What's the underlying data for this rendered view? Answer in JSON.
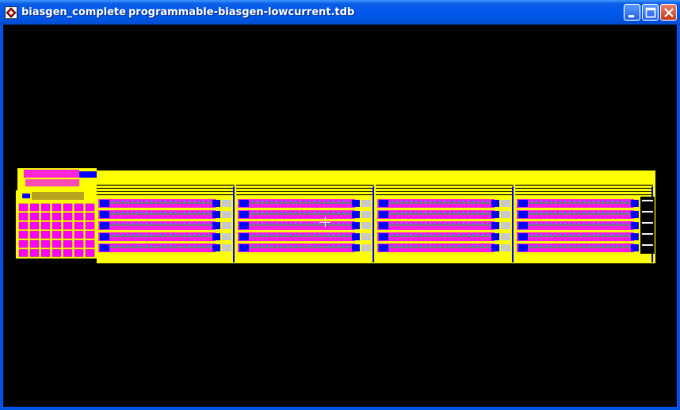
{
  "window": {
    "cell_name": "biasgen_complete",
    "file_name": "programmable-biasgen-lowcurrent.tdb"
  },
  "icons": {
    "app": "layout-editor-icon",
    "minimize": "minimize-icon",
    "maximize": "maximize-icon",
    "close": "close-icon",
    "cursor": "crosshair-cursor-icon"
  },
  "colors": {
    "background": "#000000",
    "metal": "#ffff00",
    "poly": "#ff00ff",
    "diffusion": "#0000ff",
    "titlebar": "#0058ee",
    "cursor": "#ffffff"
  },
  "layout": {
    "bank_count": 4,
    "rows_per_bank": 5,
    "pad_grid": {
      "rows": 6,
      "cols": 7
    }
  }
}
